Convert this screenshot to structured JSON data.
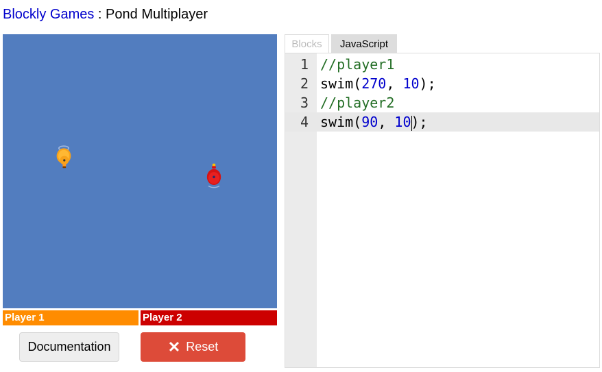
{
  "header": {
    "app_link": "Blockly Games",
    "separator": " : ",
    "page_title": "Pond Multiplayer"
  },
  "pond": {
    "background_color": "#527dbf",
    "players": [
      {
        "label": "Player 1",
        "color": "#ff8c00",
        "duck_color": "orange",
        "heading_shown": "down"
      },
      {
        "label": "Player 2",
        "color": "#cc0000",
        "duck_color": "red",
        "heading_shown": "up"
      }
    ]
  },
  "buttons": {
    "documentation": "Documentation",
    "reset": "Reset",
    "reset_icon": "close-icon"
  },
  "editor": {
    "tabs": [
      {
        "label": "Blocks",
        "active": false
      },
      {
        "label": "JavaScript",
        "active": true
      }
    ],
    "lines": [
      {
        "num": "1",
        "text": "//player1"
      },
      {
        "num": "2",
        "text": "swim(270, 10);"
      },
      {
        "num": "3",
        "text": "//player2"
      },
      {
        "num": "4",
        "text": "swim(90, 10);"
      }
    ],
    "active_line": 4,
    "colors": {
      "comment": "#236e25",
      "number": "#0000cd"
    }
  }
}
